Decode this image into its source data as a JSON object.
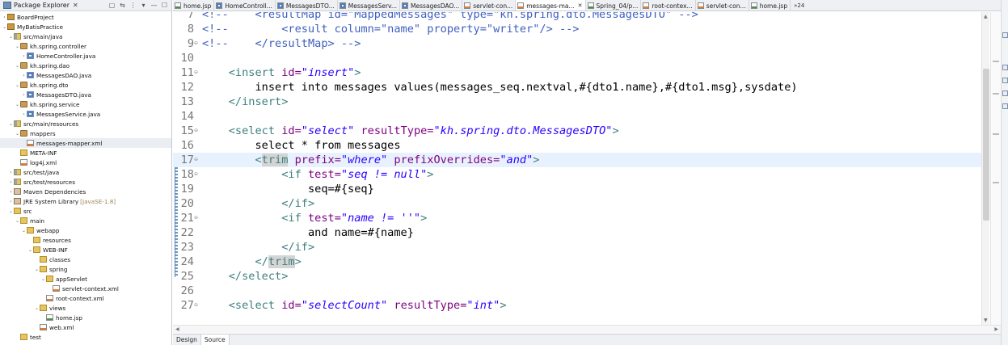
{
  "explorer": {
    "title": "Package Explorer",
    "close": "✕",
    "tools": [
      "▢",
      "⇆",
      "⋮",
      "▾",
      "—",
      "☐"
    ],
    "tree": [
      {
        "indent": 0,
        "arrow": "›",
        "icon": "i-project",
        "label": "BoardProject",
        "name": "tree-item-boardproject"
      },
      {
        "indent": 0,
        "arrow": "⌄",
        "icon": "i-project",
        "label": "MyBatisPractice",
        "name": "tree-item-mybatispractice"
      },
      {
        "indent": 1,
        "arrow": "⌄",
        "icon": "i-srcfolder",
        "label": "src/main/java",
        "name": "tree-item-src-main-java"
      },
      {
        "indent": 2,
        "arrow": "⌄",
        "icon": "i-package",
        "label": "kh.spring.controller",
        "name": "tree-item-package-controller"
      },
      {
        "indent": 3,
        "arrow": "›",
        "icon": "i-java",
        "label": "HomeController.java",
        "name": "tree-item-homecontroller"
      },
      {
        "indent": 2,
        "arrow": "⌄",
        "icon": "i-package",
        "label": "kh.spring.dao",
        "name": "tree-item-package-dao"
      },
      {
        "indent": 3,
        "arrow": "›",
        "icon": "i-java",
        "label": "MessagesDAO.java",
        "name": "tree-item-messagesdao"
      },
      {
        "indent": 2,
        "arrow": "⌄",
        "icon": "i-package",
        "label": "kh.spring.dto",
        "name": "tree-item-package-dto"
      },
      {
        "indent": 3,
        "arrow": "›",
        "icon": "i-java",
        "label": "MessagesDTO.java",
        "name": "tree-item-messagesdto"
      },
      {
        "indent": 2,
        "arrow": "⌄",
        "icon": "i-package",
        "label": "kh.spring.service",
        "name": "tree-item-package-service"
      },
      {
        "indent": 3,
        "arrow": "›",
        "icon": "i-java",
        "label": "MessagesService.java",
        "name": "tree-item-messagesservice"
      },
      {
        "indent": 1,
        "arrow": "⌄",
        "icon": "i-srcfolder",
        "label": "src/main/resources",
        "name": "tree-item-src-main-resources"
      },
      {
        "indent": 2,
        "arrow": "⌄",
        "icon": "i-package",
        "label": "mappers",
        "name": "tree-item-mappers"
      },
      {
        "indent": 3,
        "arrow": "",
        "icon": "i-xml",
        "label": "messages-mapper.xml",
        "name": "tree-item-messages-mapper",
        "selected": true
      },
      {
        "indent": 2,
        "arrow": "",
        "icon": "i-folder",
        "label": "META-INF",
        "name": "tree-item-meta-inf"
      },
      {
        "indent": 2,
        "arrow": "",
        "icon": "i-xml",
        "label": "log4j.xml",
        "name": "tree-item-log4j"
      },
      {
        "indent": 1,
        "arrow": "›",
        "icon": "i-srcfolder",
        "label": "src/test/java",
        "name": "tree-item-src-test-java"
      },
      {
        "indent": 1,
        "arrow": "›",
        "icon": "i-srcfolder",
        "label": "src/test/resources",
        "name": "tree-item-src-test-resources"
      },
      {
        "indent": 1,
        "arrow": "›",
        "icon": "i-lib",
        "label": "Maven Dependencies",
        "name": "tree-item-maven-dependencies"
      },
      {
        "indent": 1,
        "arrow": "›",
        "icon": "i-lib",
        "label": "JRE System Library",
        "suffix": "[JavaSE-1.8]",
        "name": "tree-item-jre"
      },
      {
        "indent": 1,
        "arrow": "⌄",
        "icon": "i-folder",
        "label": "src",
        "name": "tree-item-src"
      },
      {
        "indent": 2,
        "arrow": "⌄",
        "icon": "i-folder",
        "label": "main",
        "name": "tree-item-main"
      },
      {
        "indent": 3,
        "arrow": "⌄",
        "icon": "i-folder",
        "label": "webapp",
        "name": "tree-item-webapp"
      },
      {
        "indent": 4,
        "arrow": "",
        "icon": "i-folder",
        "label": "resources",
        "name": "tree-item-resources"
      },
      {
        "indent": 4,
        "arrow": "⌄",
        "icon": "i-folder",
        "label": "WEB-INF",
        "name": "tree-item-web-inf"
      },
      {
        "indent": 5,
        "arrow": "",
        "icon": "i-folder",
        "label": "classes",
        "name": "tree-item-classes"
      },
      {
        "indent": 5,
        "arrow": "⌄",
        "icon": "i-folder",
        "label": "spring",
        "name": "tree-item-spring"
      },
      {
        "indent": 6,
        "arrow": "⌄",
        "icon": "i-folder",
        "label": "appServlet",
        "name": "tree-item-appservlet"
      },
      {
        "indent": 7,
        "arrow": "",
        "icon": "i-xml",
        "label": "servlet-context.xml",
        "name": "tree-item-servlet-context"
      },
      {
        "indent": 6,
        "arrow": "",
        "icon": "i-xml",
        "label": "root-context.xml",
        "name": "tree-item-root-context"
      },
      {
        "indent": 5,
        "arrow": "⌄",
        "icon": "i-folder",
        "label": "views",
        "name": "tree-item-views"
      },
      {
        "indent": 6,
        "arrow": "",
        "icon": "i-jsp",
        "label": "home.jsp",
        "name": "tree-item-home-jsp"
      },
      {
        "indent": 5,
        "arrow": "",
        "icon": "i-xml",
        "label": "web.xml",
        "name": "tree-item-web-xml"
      },
      {
        "indent": 2,
        "arrow": "",
        "icon": "i-folder",
        "label": "test",
        "name": "tree-item-test"
      }
    ]
  },
  "tabs": [
    {
      "label": "home.jsp",
      "icon": "jsp",
      "name": "tab-home-jsp-1"
    },
    {
      "label": "HomeControll...",
      "icon": "java",
      "name": "tab-homecontroller"
    },
    {
      "label": "MessagesDTO...",
      "icon": "java",
      "name": "tab-messagesdto"
    },
    {
      "label": "MessagesServ...",
      "icon": "java",
      "name": "tab-messagesservice"
    },
    {
      "label": "MessagesDAO...",
      "icon": "java",
      "name": "tab-messagesdao"
    },
    {
      "label": "servlet-con...",
      "icon": "xml",
      "name": "tab-servlet-context-1"
    },
    {
      "label": "messages-ma...",
      "icon": "xml",
      "name": "tab-messages-mapper",
      "active": true,
      "close": "✕"
    },
    {
      "label": "Spring_04/p...",
      "icon": "jsp",
      "name": "tab-spring-04"
    },
    {
      "label": "root-contex...",
      "icon": "xml",
      "name": "tab-root-context"
    },
    {
      "label": "servlet-con...",
      "icon": "xml",
      "name": "tab-servlet-context-2"
    },
    {
      "label": "home.jsp",
      "icon": "jsp",
      "name": "tab-home-jsp-2"
    }
  ],
  "tab_overflow": "»24",
  "editor": {
    "lines": [
      {
        "no": "7",
        "fold": "",
        "segs": [
          [
            "c-com",
            "<!--    <resultMap id=\"MappedMessages\" type=\"kh.spring.dto.MessagesDTO\" -->"
          ]
        ]
      },
      {
        "no": "8",
        "fold": "",
        "segs": [
          [
            "c-com",
            "<!--        <result column=\"name\" property=\"writer\"/> -->"
          ]
        ]
      },
      {
        "no": "9",
        "fold": "⊖",
        "segs": [
          [
            "c-com",
            "<!--    </resultMap> -->"
          ]
        ]
      },
      {
        "no": "10",
        "fold": "",
        "segs": []
      },
      {
        "no": "11",
        "fold": "⊖",
        "segs": [
          [
            "",
            "    "
          ],
          [
            "c-tag",
            "<insert "
          ],
          [
            "c-attr",
            "id="
          ],
          [
            "c-val",
            "\"insert\""
          ],
          [
            "c-tag",
            ">"
          ]
        ]
      },
      {
        "no": "12",
        "fold": "",
        "segs": [
          [
            "",
            "        insert into messages values(messages_seq.nextval,#{dto1.name},#{dto1.msg},sysdate)"
          ]
        ]
      },
      {
        "no": "13",
        "fold": "",
        "segs": [
          [
            "",
            "    "
          ],
          [
            "c-tag",
            "</insert>"
          ]
        ]
      },
      {
        "no": "14",
        "fold": "",
        "segs": []
      },
      {
        "no": "15",
        "fold": "⊖",
        "segs": [
          [
            "",
            "    "
          ],
          [
            "c-tag",
            "<select "
          ],
          [
            "c-attr",
            "id="
          ],
          [
            "c-val",
            "\"select\""
          ],
          [
            "",
            " "
          ],
          [
            "c-attr",
            "resultType="
          ],
          [
            "c-val",
            "\"kh.spring.dto.MessagesDTO\""
          ],
          [
            "c-tag",
            ">"
          ]
        ]
      },
      {
        "no": "16",
        "fold": "",
        "segs": [
          [
            "",
            "        select * from messages"
          ]
        ]
      },
      {
        "no": "17",
        "fold": "⊖",
        "current": true,
        "segs": [
          [
            "",
            "        "
          ],
          [
            "c-tag",
            "<"
          ],
          [
            "c-tag c-hl",
            "trim"
          ],
          [
            "",
            " "
          ],
          [
            "c-attr",
            "prefix="
          ],
          [
            "c-val",
            "\"where\""
          ],
          [
            "",
            " "
          ],
          [
            "c-attr",
            "prefixOverrides="
          ],
          [
            "c-val",
            "\"and\""
          ],
          [
            "c-tag",
            ">"
          ]
        ]
      },
      {
        "no": "18",
        "fold": "⊖",
        "segs": [
          [
            "",
            "            "
          ],
          [
            "c-tag",
            "<if "
          ],
          [
            "c-attr",
            "test="
          ],
          [
            "c-val",
            "\"seq != null\""
          ],
          [
            "c-tag",
            ">"
          ]
        ]
      },
      {
        "no": "19",
        "fold": "",
        "segs": [
          [
            "",
            "                seq=#{seq}"
          ]
        ]
      },
      {
        "no": "20",
        "fold": "",
        "segs": [
          [
            "",
            "            "
          ],
          [
            "c-tag",
            "</if>"
          ]
        ]
      },
      {
        "no": "21",
        "fold": "⊖",
        "segs": [
          [
            "",
            "            "
          ],
          [
            "c-tag",
            "<if "
          ],
          [
            "c-attr",
            "test="
          ],
          [
            "c-val",
            "\"name != ''\""
          ],
          [
            "c-tag",
            ">"
          ]
        ]
      },
      {
        "no": "22",
        "fold": "",
        "segs": [
          [
            "",
            "                and name=#{name}"
          ]
        ]
      },
      {
        "no": "23",
        "fold": "",
        "segs": [
          [
            "",
            "            "
          ],
          [
            "c-tag",
            "</if>"
          ]
        ]
      },
      {
        "no": "24",
        "fold": "",
        "segs": [
          [
            "",
            "        "
          ],
          [
            "c-tag",
            "</"
          ],
          [
            "c-tag c-hl",
            "trim"
          ],
          [
            "c-tag",
            ">"
          ]
        ]
      },
      {
        "no": "25",
        "fold": "",
        "segs": [
          [
            "",
            "    "
          ],
          [
            "c-tag",
            "</select>"
          ]
        ]
      },
      {
        "no": "26",
        "fold": "",
        "segs": []
      },
      {
        "no": "27",
        "fold": "⊖",
        "segs": [
          [
            "",
            "    "
          ],
          [
            "c-tag",
            "<select "
          ],
          [
            "c-attr",
            "id="
          ],
          [
            "c-val",
            "\"selectCount\""
          ],
          [
            "",
            " "
          ],
          [
            "c-attr",
            "resultType="
          ],
          [
            "c-val",
            "\"int\""
          ],
          [
            "c-tag",
            ">"
          ]
        ]
      }
    ]
  },
  "bottom_tabs": [
    {
      "label": "Design",
      "name": "design-tab"
    },
    {
      "label": "Source",
      "name": "source-tab",
      "active": true
    }
  ],
  "colors": {
    "tag": "#3f7f7f",
    "attribute": "#7f007f",
    "value": "#2a00ff",
    "comment": "#3f5fbf",
    "current_line": "#e8f2fe"
  }
}
